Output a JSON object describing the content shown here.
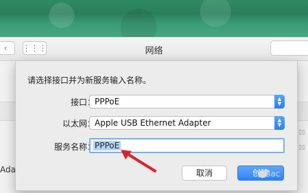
{
  "window": {
    "title": "网络"
  },
  "background": {
    "partial_text": "Adap"
  },
  "dialog": {
    "prompt": "请选择接口并为新服务输入名称。",
    "interface": {
      "label": "接口：",
      "value": "PPPoE"
    },
    "ethernet": {
      "label": "以太网：",
      "value": "Apple USB Ethernet Adapter"
    },
    "service_name": {
      "label": "服务名称：",
      "value": "PPPoE"
    },
    "buttons": {
      "cancel": "取消",
      "create": "创建"
    }
  },
  "watermark": {
    "text": "Mac"
  },
  "colors": {
    "accent": "#2e82f2",
    "arrow": "#d9232b"
  },
  "icons": {
    "back": "chevron-left-icon",
    "grid": "grid-icon",
    "stepper": "up-down-stepper-icon",
    "arrow": "red-arrow-icon"
  }
}
